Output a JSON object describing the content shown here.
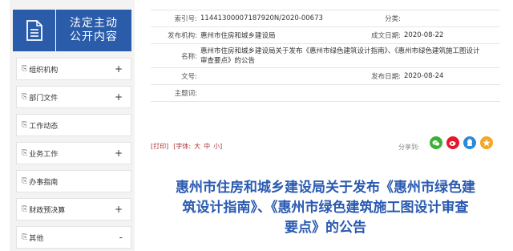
{
  "sidebar": {
    "title_line1": "法定主动",
    "title_line2": "公开内容",
    "items": [
      {
        "label": "组织机构",
        "toggle": "+"
      },
      {
        "label": "部门文件",
        "toggle": "+"
      },
      {
        "label": "工作动态",
        "toggle": ""
      },
      {
        "label": "业务工作",
        "toggle": "+"
      },
      {
        "label": "办事指南",
        "toggle": ""
      },
      {
        "label": "财政预决算",
        "toggle": "+"
      },
      {
        "label": "其他",
        "toggle": "-"
      }
    ]
  },
  "meta": {
    "index_label": "索引号:",
    "index_value": "11441300007187920N/2020-00673",
    "category_label": "分类:",
    "category_value": "",
    "publisher_label": "发布机构:",
    "publisher_value": "惠州市住房和城乡建设局",
    "created_label": "成文日期:",
    "created_value": "2020-08-22",
    "name_label": "名称:",
    "name_value": "惠州市住房和城乡建设局关于发布《惠州市绿色建筑设计指南》、《惠州市绿色建筑施工图设计审查要点》的公告",
    "docno_label": "文号:",
    "docno_value": "",
    "published_label": "发布日期:",
    "published_value": "2020-08-24",
    "subject_label": "主题词:",
    "subject_value": ""
  },
  "toolbar": {
    "print_label": "[打印]",
    "font_label": "[字体:",
    "font_large": "大",
    "font_medium": "中",
    "font_small": "小",
    "font_close": "]",
    "share_label": "分享到:"
  },
  "share_icons": [
    {
      "name": "wechat-icon",
      "glyph": "◎",
      "color": "#3cb034"
    },
    {
      "name": "weibo-icon",
      "glyph": "◉",
      "color": "#e6162d"
    },
    {
      "name": "qq-icon",
      "glyph": "●",
      "color": "#2d8ad6"
    },
    {
      "name": "qzone-icon",
      "glyph": "★",
      "color": "#f5a623"
    }
  ],
  "article": {
    "title_line1": "惠州市住房和城乡建设局关于发布《惠州市绿色建",
    "title_line2": "筑设计指南》、《惠州市绿色建筑施工图设计审查",
    "title_line3": "要点》的公告"
  }
}
